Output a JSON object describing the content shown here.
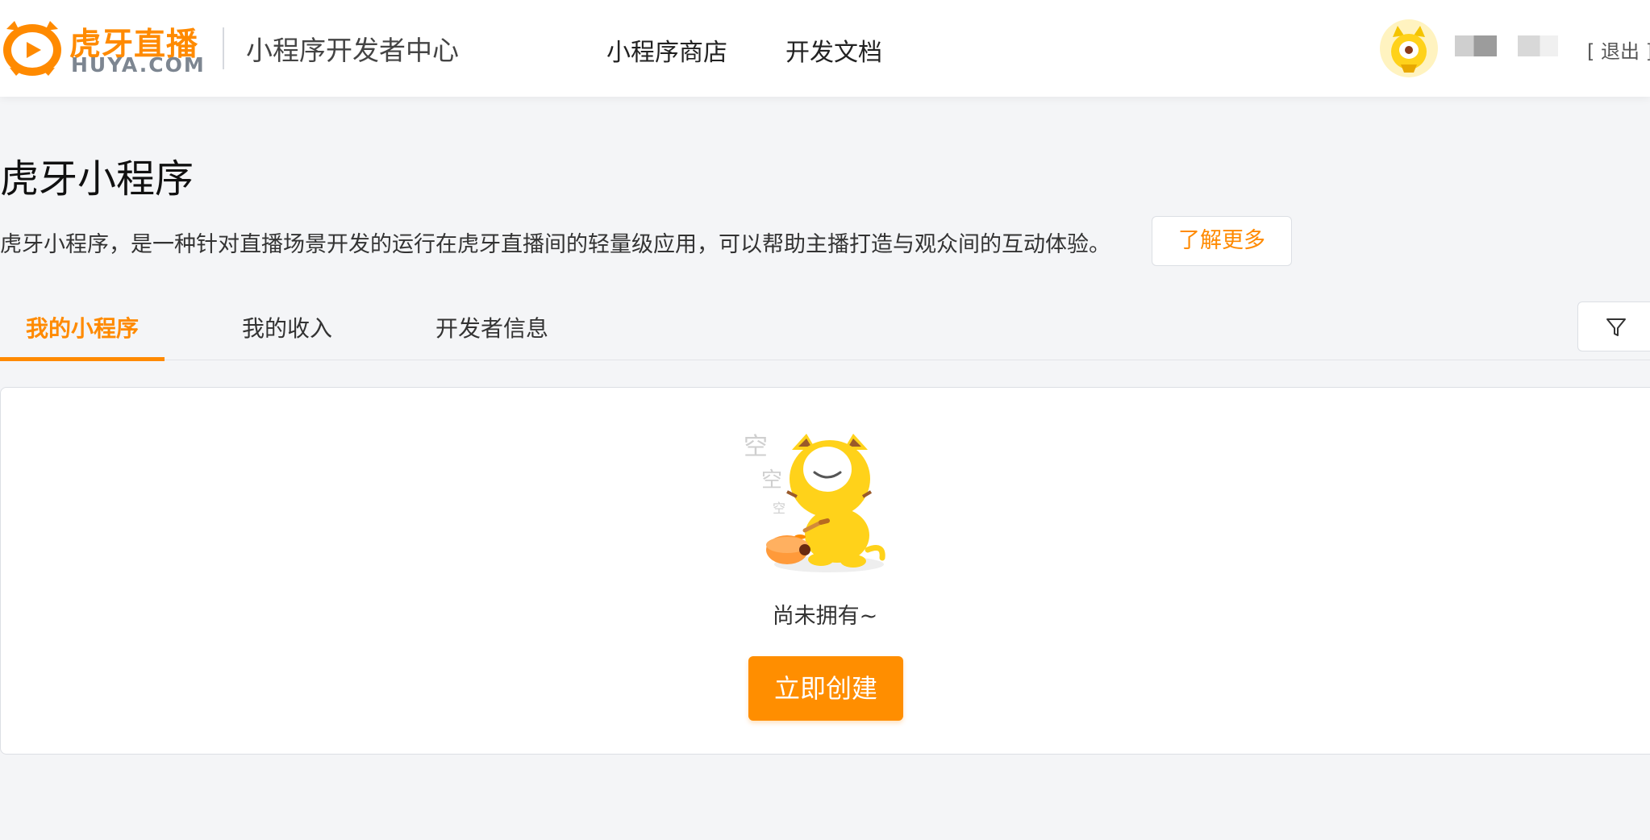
{
  "header": {
    "logo_cn": "虎牙直播",
    "logo_en": "HUYA.COM",
    "site_title": "小程序开发者中心",
    "nav": [
      {
        "label": "小程序商店"
      },
      {
        "label": "开发文档"
      }
    ],
    "logout_label": "[ 退出 ]"
  },
  "intro": {
    "title": "虎牙小程序",
    "description": "虎牙小程序，是一种针对直播场景开发的运行在虎牙直播间的轻量级应用，可以帮助主播打造与观众间的互动体验。",
    "learn_more_label": "了解更多"
  },
  "tabs": [
    {
      "label": "我的小程序",
      "active": true
    },
    {
      "label": "我的收入",
      "active": false
    },
    {
      "label": "开发者信息",
      "active": false
    }
  ],
  "filter_icon": "filter-icon",
  "empty_state": {
    "illustration_text": [
      "空",
      "空",
      "空"
    ],
    "message": "尚未拥有~",
    "create_label": "立即创建"
  },
  "colors": {
    "accent": "#ff8a00",
    "background": "#f4f5f7"
  }
}
